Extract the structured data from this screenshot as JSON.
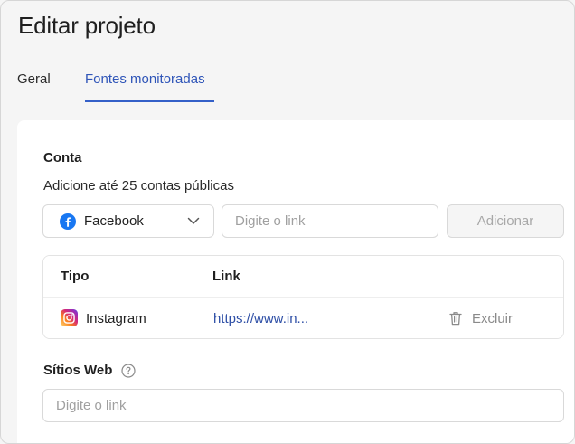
{
  "header": {
    "title": "Editar projeto"
  },
  "tabs": [
    {
      "label": "Geral",
      "active": false
    },
    {
      "label": "Fontes monitoradas",
      "active": true
    }
  ],
  "account": {
    "label": "Conta",
    "helper": "Adicione até 25 contas públicas",
    "platform_select": {
      "value": "Facebook",
      "icon": "facebook-icon"
    },
    "link_input": {
      "value": "",
      "placeholder": "Digite o link"
    },
    "add_button": {
      "label": "Adicionar",
      "disabled": true
    }
  },
  "table": {
    "columns": [
      "Tipo",
      "Link"
    ],
    "rows": [
      {
        "type": "Instagram",
        "icon": "instagram-icon",
        "link": "https://www.in...",
        "delete_label": "Excluir"
      }
    ]
  },
  "websites": {
    "label": "Sítios Web",
    "input": {
      "value": "",
      "placeholder": "Digite o link"
    }
  },
  "colors": {
    "accent": "#3460c8",
    "link": "#2e4fa6",
    "facebook": "#1877f2"
  }
}
